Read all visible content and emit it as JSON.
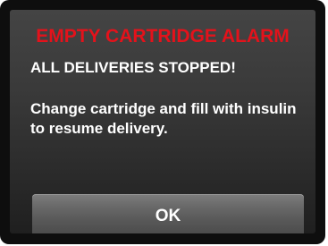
{
  "alarm": {
    "title": "EMPTY CARTRIDGE ALARM",
    "headline": "ALL DELIVERIES STOPPED!",
    "message": "Change cartridge and fill with insulin to resume delivery.",
    "ok_label": "OK"
  },
  "colors": {
    "title": "#e4121b",
    "text": "#ffffff",
    "bezel": "#0e0e0e",
    "button": "#6a6a6a"
  }
}
